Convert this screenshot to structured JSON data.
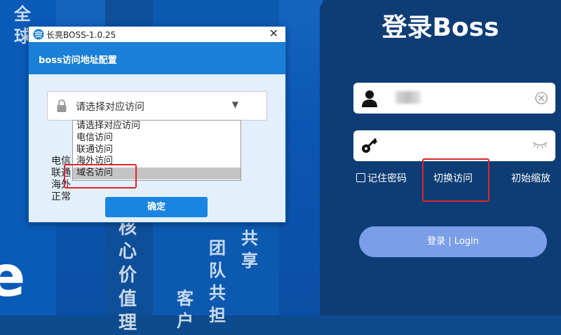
{
  "background": {
    "left_col_chars": [
      "全",
      "球"
    ],
    "col_chars_a": [
      "核",
      "心",
      "价",
      "值",
      "理"
    ],
    "col_chars_b": [
      "团",
      "队",
      "共",
      "担"
    ],
    "col_chars_c": [
      "共",
      "享"
    ],
    "col_chars_d": [
      "客",
      "户"
    ],
    "big_letter": "e"
  },
  "login": {
    "title": "登录Boss",
    "username_icon": "user-icon",
    "password_icon": "key-icon",
    "clear_icon": "clear-icon",
    "eye_icon": "eye-closed-icon",
    "remember_label": "记住密码",
    "switch_label": "切换访问",
    "reset_zoom_label": "初始缩放",
    "login_button": "登录 | Login",
    "button_color": "#7a9ee8",
    "highlight_color": "#e0232e"
  },
  "dialog": {
    "window_title": "长亮BOSS-1.0.25",
    "close_glyph": "✕",
    "header": "boss访问地址配置",
    "select_value": "请选择对应访问",
    "select_arrow": "▼",
    "behind_lines": [
      "电信",
      "联通",
      "海外",
      "正常"
    ],
    "options": [
      "请选择对应访问",
      "电信访问",
      "联通访问",
      "海外访问",
      "域名访问"
    ],
    "selected_option": "域名访问",
    "confirm_button": "确定",
    "accent_color": "#1a7fd6"
  }
}
